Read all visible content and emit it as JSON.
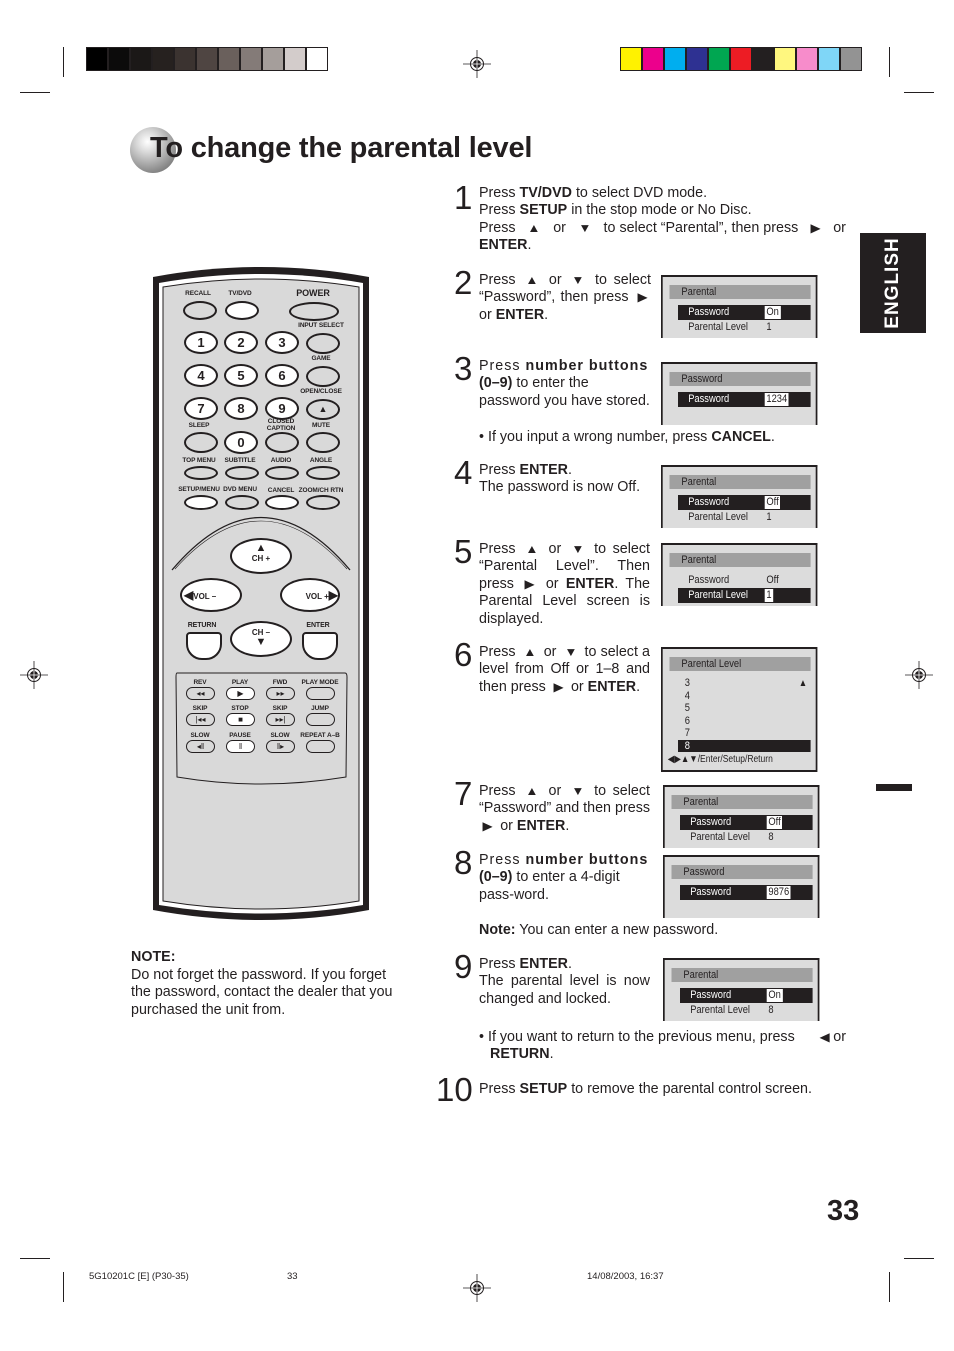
{
  "print_marks": {
    "grayscale_bar": [
      "#000000",
      "#0c0b0b",
      "#1b1817",
      "#26211f",
      "#3b3330",
      "#4f4542",
      "#6a605c",
      "#847b78",
      "#a59e9b",
      "#d3cccb",
      "#ffffff"
    ],
    "color_bar": [
      "#fff200",
      "#ec008c",
      "#00aeef",
      "#2e3192",
      "#00a651",
      "#ed1c24",
      "#231f20",
      "#fff77f",
      "#f78ccb",
      "#7fd6f7",
      "#939393"
    ]
  },
  "page": {
    "title": "To change the parental level",
    "language_tab": "ENGLISH",
    "page_number": "33"
  },
  "remote": {
    "labels": {
      "recall": "RECALL",
      "tvdvd": "TV/DVD",
      "power": "POWER",
      "input_select": "INPUT SELECT",
      "game": "GAME",
      "open_close": "OPEN/CLOSE",
      "sleep": "SLEEP",
      "closed_caption_1": "CLOSED",
      "closed_caption_2": "CAPTION",
      "mute": "MUTE",
      "top_menu": "TOP MENU",
      "subtitle": "SUBTITLE",
      "audio": "AUDIO",
      "angle": "ANGLE",
      "setup_menu": "SETUP/MENU",
      "dvd_menu": "DVD MENU",
      "cancel": "CANCEL",
      "zoom_ch_rtn": "ZOOM/CH RTN",
      "ch_plus": "CH +",
      "ch_minus": "CH –",
      "vol_minus": "VOL –",
      "vol_plus": "VOL +",
      "return": "RETURN",
      "enter": "ENTER",
      "rev": "REV",
      "play": "PLAY",
      "fwd": "FWD",
      "play_mode": "PLAY MODE",
      "skip_back": "SKIP",
      "stop": "STOP",
      "skip_fwd": "SKIP",
      "jump": "JUMP",
      "slow_back": "SLOW",
      "pause": "PAUSE",
      "slow_fwd": "SLOW",
      "repeat_ab": "REPEAT A–B"
    },
    "digits": [
      "1",
      "2",
      "3",
      "4",
      "5",
      "6",
      "7",
      "8",
      "9",
      "0"
    ]
  },
  "note": {
    "heading": "NOTE:",
    "body": "Do not forget the password. If you forget the password, contact the dealer that you purchased the unit from."
  },
  "steps": [
    {
      "num": "1"
    },
    {
      "num": "2"
    },
    {
      "num": "3"
    },
    {
      "num": "4"
    },
    {
      "num": "5"
    },
    {
      "num": "6"
    },
    {
      "num": "7"
    },
    {
      "num": "8"
    },
    {
      "num": "9"
    },
    {
      "num": "10"
    }
  ],
  "text": {
    "press": "Press",
    "or": "or",
    "tvdvd": "TV/DVD",
    "setup": "SETUP",
    "enter": "ENTER",
    "cancel": "CANCEL",
    "return": "RETURN",
    "number_buttons": "number buttons",
    "zero_nine": "(0–9)",
    "note_label": "Note:",
    "s1a": "to select DVD mode.",
    "s1b": "in the stop mode or No Disc.",
    "s1c": "to select “Parental”, then press",
    "s2a": "to select “Password”, then press",
    "s3a": "to enter the password you have stored.",
    "s3bullet": "• If you input a wrong number, press",
    "s4a": "The password is now Off.",
    "s5a": "to select “Parental Level”. Then press",
    "s5b": ". The Parental Level screen is displayed.",
    "s6a": "to select a level from Off or 1–8 and then press",
    "s7a": "to select “Password” and then press",
    "s8a": "to enter a 4-digit pass-word.",
    "s8note": "You can enter a new password.",
    "s9a": "The parental level is now changed and locked.",
    "s9bullet": "• If you want to return to the previous menu, press",
    "s10a": "to remove the parental control screen."
  },
  "screens": {
    "s2": {
      "header": "Parental",
      "rows": [
        {
          "label": "Password",
          "value": "On",
          "selected": true
        },
        {
          "label": "Parental Level",
          "value": "1",
          "selected": false
        }
      ]
    },
    "s3": {
      "header": "Password",
      "rows": [
        {
          "label": "Password",
          "value": "1234",
          "selected": true
        }
      ]
    },
    "s4": {
      "header": "Parental",
      "rows": [
        {
          "label": "Password",
          "value": "Off",
          "selected": true
        },
        {
          "label": "Parental Level",
          "value": "1",
          "selected": false
        }
      ]
    },
    "s5": {
      "header": "Parental",
      "rows": [
        {
          "label": "Password",
          "value": "Off",
          "selected": false
        },
        {
          "label": "Parental Level",
          "value": "1",
          "selected": true
        }
      ]
    },
    "s6": {
      "header": "Parental Level",
      "levels": [
        "3",
        "4",
        "5",
        "6",
        "7",
        "8"
      ],
      "selected": "8",
      "hint": "◀▶▲▼/Enter/Setup/Return"
    },
    "s7": {
      "header": "Parental",
      "rows": [
        {
          "label": "Password",
          "value": "Off",
          "selected": true
        },
        {
          "label": "Parental Level",
          "value": "8",
          "selected": false
        }
      ]
    },
    "s8": {
      "header": "Password",
      "rows": [
        {
          "label": "Password",
          "value": "9876",
          "selected": true
        }
      ]
    },
    "s9": {
      "header": "Parental",
      "rows": [
        {
          "label": "Password",
          "value": "On",
          "selected": true
        },
        {
          "label": "Parental Level",
          "value": "8",
          "selected": false
        }
      ]
    }
  },
  "footer": {
    "doc_id": "5G10201C [E] (P30-35)",
    "page": "33",
    "timestamp": "14/08/2003, 16:37"
  }
}
